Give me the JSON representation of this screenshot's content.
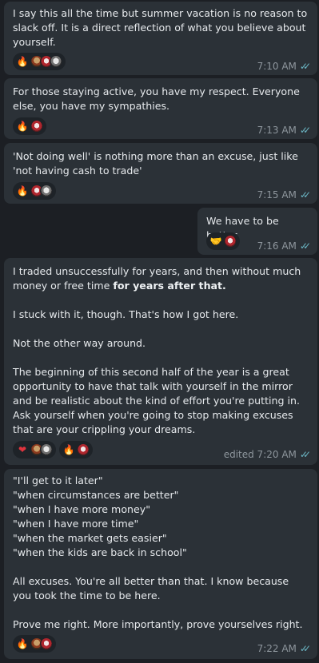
{
  "messages": [
    {
      "id": "m1",
      "text": "I say this all the time but summer vacation is no reason to slack off. It is a direct reflection of what you believe about yourself.",
      "time": "7:10 AM",
      "reactions": [
        {
          "emoji": "🔥",
          "icon": "fire-icon",
          "avatars": [
            "avatar-1",
            "avatar-2",
            "avatar-3"
          ]
        }
      ]
    },
    {
      "id": "m2",
      "text": "For those staying active, you have my respect. Everyone else, you have my sympathies.",
      "time": "7:13 AM",
      "reactions": [
        {
          "emoji": "🔥",
          "icon": "fire-icon",
          "avatars": [
            "avatar-2"
          ]
        }
      ]
    },
    {
      "id": "m3",
      "text": "'Not doing well' is nothing more than an excuse, just like 'not having cash to trade'",
      "time": "7:15 AM",
      "reactions": [
        {
          "emoji": "🔥",
          "icon": "fire-icon",
          "avatars": [
            "avatar-2",
            "avatar-3"
          ]
        }
      ]
    },
    {
      "id": "m4",
      "text": "We have to be better.",
      "time": "7:16 AM",
      "reactions": [
        {
          "emoji": "🤝",
          "icon": "handshake-icon",
          "avatars": [
            "avatar-2"
          ]
        }
      ]
    },
    {
      "id": "m5",
      "text_before_bold": "I traded unsuccessfully for years, and then without much money or free time ",
      "text_bold": "for years after that.",
      "text_after": "I stuck with it, though. That's how I got here.\n\nNot the other way around.\n\nThe beginning of this second half of the year is a great opportunity to have that talk with yourself in the mirror and be realistic about the kind of effort you're putting in. Ask yourself when you're going to stop making excuses that are your crippling your dreams.",
      "time": "edited 7:20 AM",
      "reactions": [
        {
          "emoji": "❤",
          "icon": "heart-icon",
          "avatars": [
            "avatar-1",
            "avatar-3"
          ]
        },
        {
          "emoji": "🔥",
          "icon": "fire-icon",
          "avatars": [
            "avatar-2"
          ]
        }
      ]
    },
    {
      "id": "m6",
      "text": "\"I'll get to it later\"\n\"when circumstances are better\"\n\"when I have more money\"\n\"when I have more time\"\n\"when the market gets easier\"\n\"when the kids are back in school\"\n\nAll excuses. You're all better than that. I know because you took the time to be here.\n\nProve me right. More importantly, prove yourselves right.",
      "time": "7:22 AM",
      "reactions": [
        {
          "emoji": "🔥",
          "icon": "fire-icon",
          "avatars": [
            "avatar-1",
            "avatar-2"
          ]
        }
      ]
    }
  ],
  "colors": {
    "background": "#1c1f24",
    "bubble": "#2b3137",
    "text": "#e6e9ec",
    "meta": "#8e969d",
    "read_check": "#6bb6c4"
  }
}
